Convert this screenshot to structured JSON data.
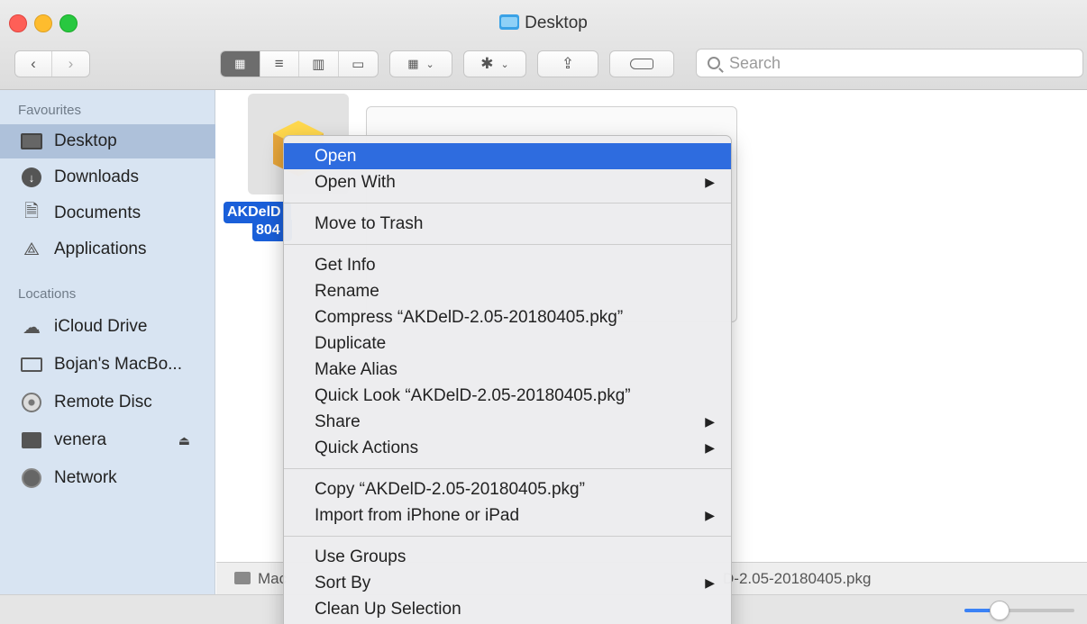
{
  "window": {
    "title": "Desktop"
  },
  "search": {
    "placeholder": "Search"
  },
  "sidebar": {
    "favourites_title": "Favourites",
    "favourites": [
      {
        "label": "Desktop",
        "icon": "desktop-icon"
      },
      {
        "label": "Downloads",
        "icon": "download-icon"
      },
      {
        "label": "Documents",
        "icon": "documents-icon"
      },
      {
        "label": "Applications",
        "icon": "applications-icon"
      }
    ],
    "locations_title": "Locations",
    "locations": [
      {
        "label": "iCloud Drive",
        "icon": "cloud-icon"
      },
      {
        "label": "Bojan's MacBo...",
        "icon": "laptop-icon"
      },
      {
        "label": "Remote Disc",
        "icon": "disc-icon"
      },
      {
        "label": "venera",
        "icon": "monitor-icon"
      },
      {
        "label": "Network",
        "icon": "globe-icon"
      }
    ],
    "eject_glyph": "⏏"
  },
  "file": {
    "label_line1": "AKDelD",
    "label_line2": "804"
  },
  "pathbar": {
    "left": "Mac",
    "right": "D-2.05-20180405.pkg"
  },
  "zoom": {
    "level": 0.32
  },
  "context_menu": {
    "groups": [
      [
        {
          "label": "Open",
          "submenu": false,
          "highlighted": true
        },
        {
          "label": "Open With",
          "submenu": true
        }
      ],
      [
        {
          "label": "Move to Trash",
          "submenu": false
        }
      ],
      [
        {
          "label": "Get Info",
          "submenu": false
        },
        {
          "label": "Rename",
          "submenu": false
        },
        {
          "label": "Compress “AKDelD-2.05-20180405.pkg”",
          "submenu": false
        },
        {
          "label": "Duplicate",
          "submenu": false
        },
        {
          "label": "Make Alias",
          "submenu": false
        },
        {
          "label": "Quick Look “AKDelD-2.05-20180405.pkg”",
          "submenu": false
        },
        {
          "label": "Share",
          "submenu": true
        },
        {
          "label": "Quick Actions",
          "submenu": true
        }
      ],
      [
        {
          "label": "Copy “AKDelD-2.05-20180405.pkg”",
          "submenu": false
        },
        {
          "label": "Import from iPhone or iPad",
          "submenu": true
        }
      ],
      [
        {
          "label": "Use Groups",
          "submenu": false
        },
        {
          "label": "Sort By",
          "submenu": true
        },
        {
          "label": "Clean Up Selection",
          "submenu": false
        }
      ]
    ],
    "submenu_arrow": "▶"
  },
  "colors": {
    "selection": "#2e6cdf",
    "sidebar_bg": "#d8e4f2",
    "sidebar_selected": "#aec1da"
  }
}
